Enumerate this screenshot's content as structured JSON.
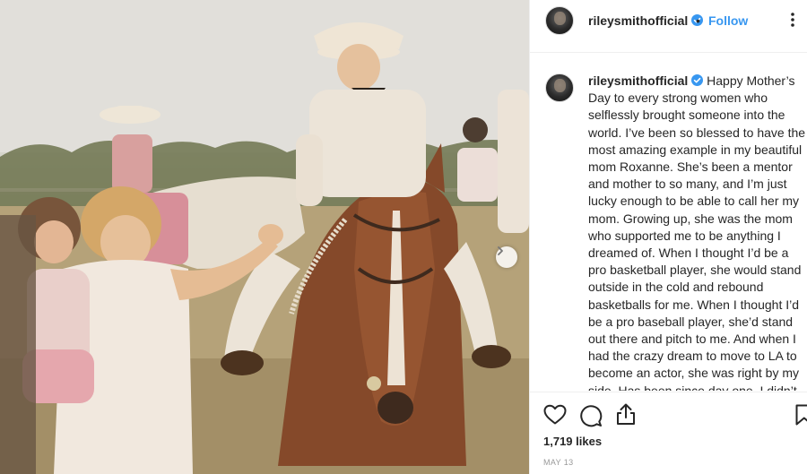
{
  "photo": {
    "alt_icon": "photo-image"
  },
  "header": {
    "username": "rileysmithofficial",
    "separator": "•",
    "follow_label": "Follow"
  },
  "caption": {
    "username": "rileysmithofficial",
    "text": "Happy Mother’s Day to every strong women who selflessly brought someone into the world. I’ve been so blessed to have the most amazing example in my beautiful mom Roxanne. She’s been a mentor and mother to so many, and I’m just lucky enough to be able to call her my mom. Growing up, she was the mom who supported me to be anything I dreamed of. When I thought I’d be a pro basketball player, she would stand outside in the cold and rebound basketballs for me. When I thought I’d be a pro baseball player, she’d stand out there and pitch to me. And when I had the crazy dream to move to LA to become an actor, she was right by my side. Has been since day one. I didn’t always win and I wasn’t always the"
  },
  "engagement": {
    "likes": "1,719 likes",
    "date": "MAY 13"
  },
  "colors": {
    "accent": "#3897f0",
    "text": "#262626",
    "muted": "#999999",
    "border": "#efefef"
  }
}
